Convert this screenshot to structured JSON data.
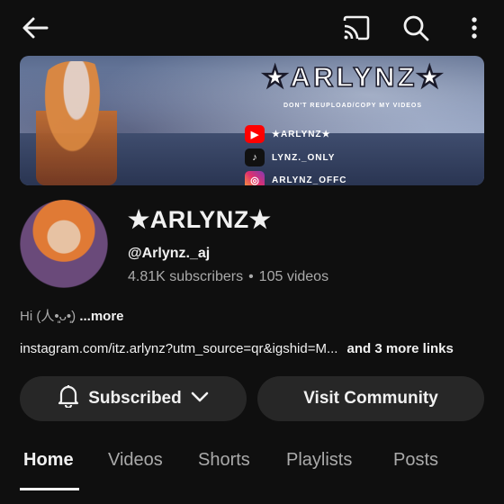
{
  "banner": {
    "title": "★ARLYNZ★",
    "subtitle": "DON'T REUPLOAD/COPY MY VIDEOS",
    "socials": [
      {
        "icon": "youtube-icon",
        "label": "★ARLYNZ★"
      },
      {
        "icon": "tiktok-icon",
        "label": "LYNZ._ONLY"
      },
      {
        "icon": "instagram-icon",
        "label": "ARLYNZ_OFFC"
      }
    ]
  },
  "channel": {
    "name": "★ARLYNZ★",
    "handle": "@Arlynz._aj",
    "subscribers": "4.81K subscribers",
    "videos": "105 videos",
    "separator": "•"
  },
  "description": {
    "text": "Hi (人•͈ᴗ•͈)",
    "more": "...more"
  },
  "links": {
    "url": "instagram.com/itz.arlynz?utm_source=qr&igshid=M...",
    "extra": "and 3 more links"
  },
  "actions": {
    "subscribed": "Subscribed",
    "visit": "Visit Community"
  },
  "tabs": [
    "Home",
    "Videos",
    "Shorts",
    "Playlists",
    "Posts"
  ],
  "colors": {
    "background": "#0f0f0f",
    "pill": "#272727",
    "secondary_text": "#aaaaaa",
    "primary_text": "#f1f1f1"
  }
}
